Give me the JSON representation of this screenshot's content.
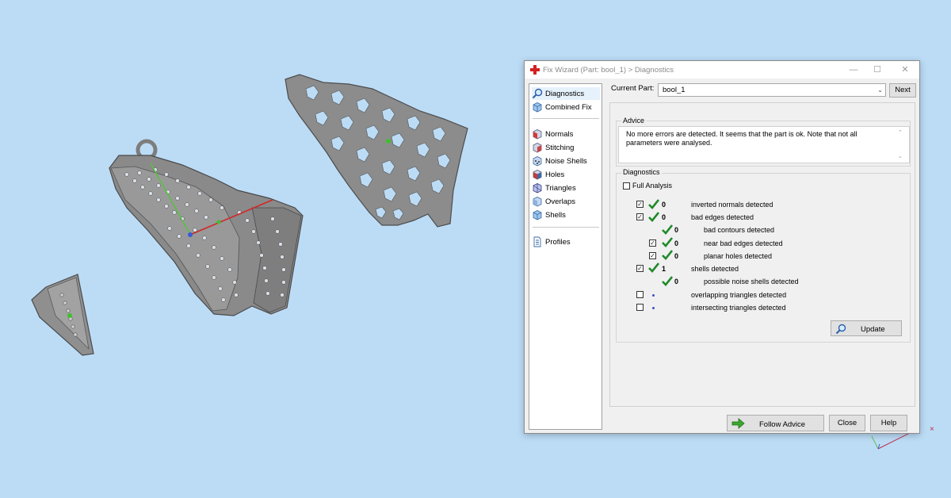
{
  "window": {
    "title": "Fix Wizard (Part: bool_1) > Diagnostics",
    "controls": {
      "minimize": "—",
      "maximize": "☐",
      "close": "✕"
    }
  },
  "nav": {
    "items": [
      {
        "label": "Diagnostics",
        "icon": "magnifier-icon",
        "selected": true
      },
      {
        "label": "Combined Fix",
        "icon": "cube-icon"
      },
      {
        "label": "Normals",
        "icon": "normals-icon"
      },
      {
        "label": "Stitching",
        "icon": "stitching-icon"
      },
      {
        "label": "Noise Shells",
        "icon": "noise-shells-icon"
      },
      {
        "label": "Holes",
        "icon": "holes-icon"
      },
      {
        "label": "Triangles",
        "icon": "triangles-icon"
      },
      {
        "label": "Overlaps",
        "icon": "overlaps-icon"
      },
      {
        "label": "Shells",
        "icon": "shells-icon"
      },
      {
        "label": "Profiles",
        "icon": "document-icon"
      }
    ]
  },
  "current_part": {
    "label": "Current Part:",
    "value": "bool_1",
    "next_label": "Next"
  },
  "advice": {
    "title": "Advice",
    "text": "No more errors are detected. It seems that the part is ok. Note that not all parameters were analysed."
  },
  "diagnostics": {
    "title": "Diagnostics",
    "full_analysis_label": "Full Analysis",
    "full_analysis_checked": false,
    "rows": [
      {
        "checked": true,
        "status": "ok",
        "count": "0",
        "label": "inverted normals detected",
        "indent": 0
      },
      {
        "checked": true,
        "status": "ok",
        "count": "0",
        "label": "bad edges detected",
        "indent": 0
      },
      {
        "checked": null,
        "status": "ok",
        "count": "0",
        "label": "bad contours detected",
        "indent": 1
      },
      {
        "checked": true,
        "status": "ok",
        "count": "0",
        "label": "near bad edges detected",
        "indent": 1
      },
      {
        "checked": true,
        "status": "ok",
        "count": "0",
        "label": "planar holes detected",
        "indent": 1
      },
      {
        "checked": true,
        "status": "ok",
        "count": "1",
        "label": "shells detected",
        "indent": 0
      },
      {
        "checked": null,
        "status": "ok",
        "count": "0",
        "label": "possible noise shells detected",
        "indent": 1
      },
      {
        "checked": false,
        "status": "none",
        "count": "",
        "label": "overlapping triangles detected",
        "indent": 0
      },
      {
        "checked": false,
        "status": "none",
        "count": "",
        "label": "intersecting triangles detected",
        "indent": 0
      }
    ],
    "update_label": "Update"
  },
  "footer": {
    "follow_advice_label": "Follow Advice",
    "close_label": "Close",
    "help_label": "Help"
  },
  "colors": {
    "background": "#bcdcf6",
    "model_gray": "#8d8d8d",
    "check_green": "#1f8a2a",
    "arrow_green": "#3aa82e"
  }
}
